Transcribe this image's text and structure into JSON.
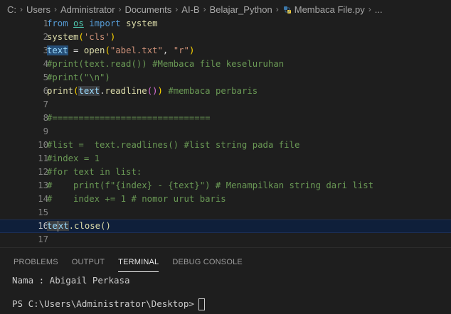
{
  "breadcrumb": {
    "items": [
      "C:",
      "Users",
      "Administrator",
      "Documents",
      "AI-B",
      "Belajar_Python"
    ],
    "file": "Membaca File.py",
    "trail": "..."
  },
  "editor": {
    "line_numbers": [
      "1",
      "2",
      "3",
      "4",
      "5",
      "6",
      "7",
      "8",
      "9",
      "10",
      "11",
      "12",
      "13",
      "14",
      "15",
      "16",
      "17"
    ],
    "active_line": "16"
  },
  "code": {
    "l1": [
      "from",
      "os",
      "import",
      "system"
    ],
    "l2": [
      "system",
      "(",
      "'cls'",
      ")"
    ],
    "l3": [
      "text",
      " = ",
      "open",
      "(",
      "\"abel.txt\"",
      ", ",
      "\"r\"",
      ")"
    ],
    "l4": "#print(text.read()) #Membaca file keseluruhan",
    "l5": "#print(\"\\n\")",
    "l6": [
      "print",
      "(",
      "text",
      ".",
      "readline",
      "()",
      ")",
      " #membaca perbaris"
    ],
    "l8": "#==============================",
    "l10": "#list =  text.readlines() #list string pada file",
    "l11": "#index = 1",
    "l12": "#for text in list:",
    "l13": "#    print(f\"{index} - {text}\") # Menampilkan string dari list",
    "l14": "#    index += 1 # nomor urut baris",
    "l16": [
      "te",
      "xt",
      ".close()"
    ]
  },
  "panel": {
    "tabs": [
      "PROBLEMS",
      "OUTPUT",
      "TERMINAL",
      "DEBUG CONSOLE"
    ],
    "active_tab": "TERMINAL",
    "output_line": "Nama : Abigail Perkasa",
    "prompt": "PS C:\\Users\\Administrator\\Desktop>"
  },
  "colors": {
    "background": "#1e1e1e",
    "keyword": "#569cd6",
    "function": "#dcdcaa",
    "string": "#ce9178",
    "variable": "#9cdcfe",
    "comment": "#6a9955",
    "selection": "#264f78"
  }
}
